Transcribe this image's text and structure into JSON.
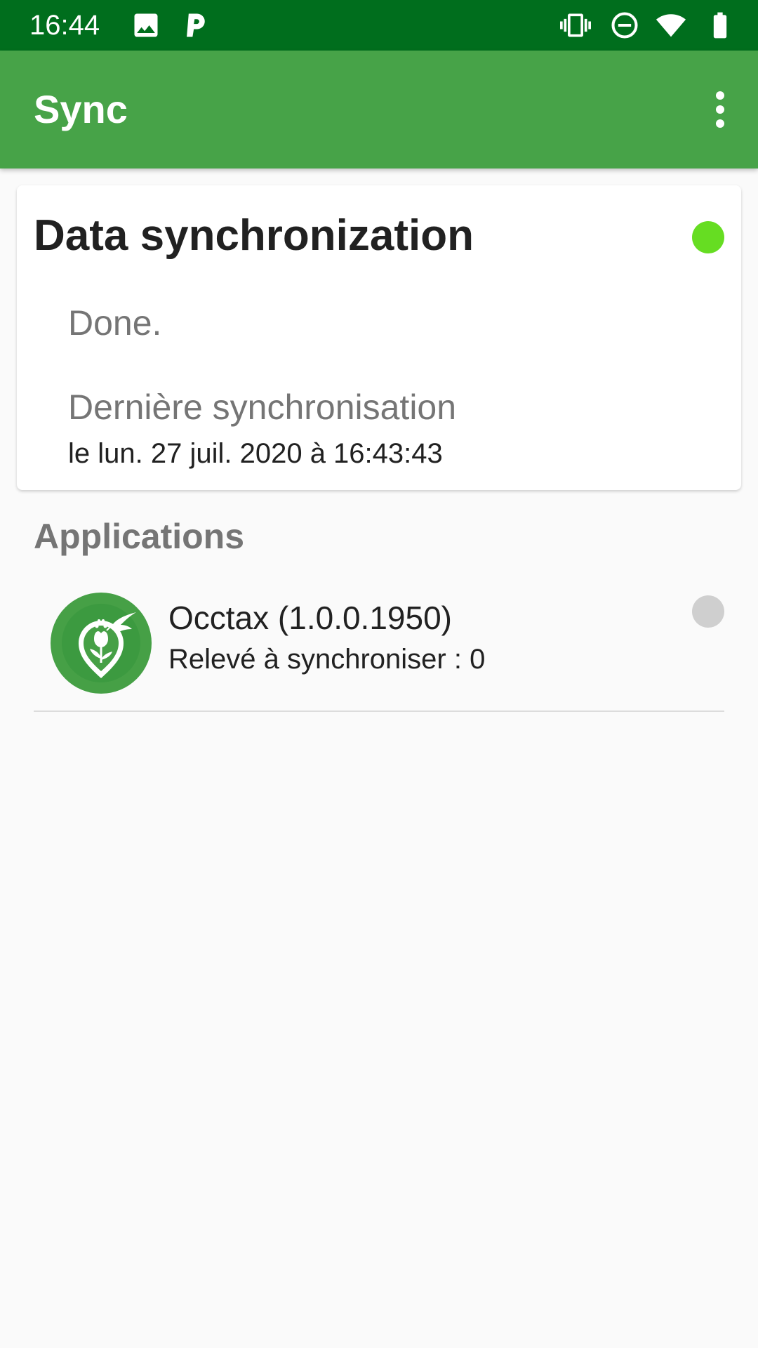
{
  "status_bar": {
    "time": "16:44",
    "left_icons": [
      "image-icon",
      "parking-p-icon"
    ],
    "right_icons": [
      "vibrate-icon",
      "do-not-disturb-icon",
      "wifi-icon",
      "battery-icon"
    ],
    "background_color": "#006e1d"
  },
  "app_bar": {
    "title": "Sync",
    "overflow_icon": "more-vert-icon",
    "background_color": "#47a348"
  },
  "sync_card": {
    "title": "Data synchronization",
    "status_indicator_color": "#66dd22",
    "state_text": "Done.",
    "last_sync_label": "Dernière synchronisation",
    "last_sync_value": "le lun. 27 juil. 2020 à 16:43:43"
  },
  "applications": {
    "header": "Applications",
    "items": [
      {
        "icon": "occtax-logo-icon",
        "name": "Occtax (1.0.0.1950)",
        "subtitle": "Relevé à synchroniser : 0",
        "status_indicator_color": "#cfcfcf"
      }
    ]
  }
}
